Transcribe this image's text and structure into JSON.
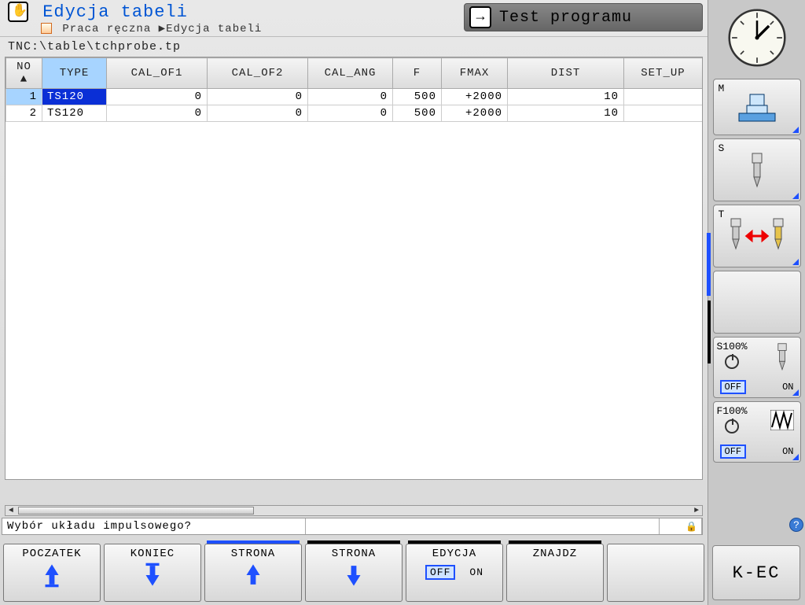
{
  "header": {
    "title": "Edycja tabeli",
    "breadcrumb_root": "Praca ręczna",
    "breadcrumb_current": "Edycja tabeli",
    "mode": "Test programu"
  },
  "file_path": "TNC:\\table\\tchprobe.tp",
  "columns": [
    "NO",
    "TYPE",
    "CAL_OF1",
    "CAL_OF2",
    "CAL_ANG",
    "F",
    "FMAX",
    "DIST",
    "SET_UP"
  ],
  "sort_indicator": "▲",
  "selected_col_index": 1,
  "rows": [
    {
      "no": "1",
      "type": "TS120",
      "cal_of1": "0",
      "cal_of2": "0",
      "cal_ang": "0",
      "f": "500",
      "fmax": "+2000",
      "dist": "10",
      "set_up": ""
    },
    {
      "no": "2",
      "type": "TS120",
      "cal_of1": "0",
      "cal_of2": "0",
      "cal_ang": "0",
      "f": "500",
      "fmax": "+2000",
      "dist": "10",
      "set_up": ""
    }
  ],
  "selected_row": 0,
  "message": "Wybór układu impulsowego?",
  "softkeys": [
    {
      "label": "POCZATEK",
      "icon": "arrow-up-bar",
      "bar": ""
    },
    {
      "label": "KONIEC",
      "icon": "arrow-down-bar",
      "bar": ""
    },
    {
      "label": "STRONA",
      "icon": "arrow-up",
      "bar": "blue"
    },
    {
      "label": "STRONA",
      "icon": "arrow-down",
      "bar": "black"
    },
    {
      "label": "EDYCJA",
      "icon": "toggle",
      "bar": "black",
      "off": "OFF",
      "on": "ON"
    },
    {
      "label": "ZNAJDZ",
      "icon": "",
      "bar": "black"
    },
    {
      "label": "",
      "icon": "",
      "bar": ""
    }
  ],
  "right": {
    "m_label": "M",
    "s_label": "S",
    "t_label": "T",
    "s100": {
      "label": "S100%",
      "off": "OFF",
      "on": "ON"
    },
    "f100": {
      "label": "F100%",
      "off": "OFF",
      "on": "ON"
    },
    "kec": "K-EC"
  }
}
